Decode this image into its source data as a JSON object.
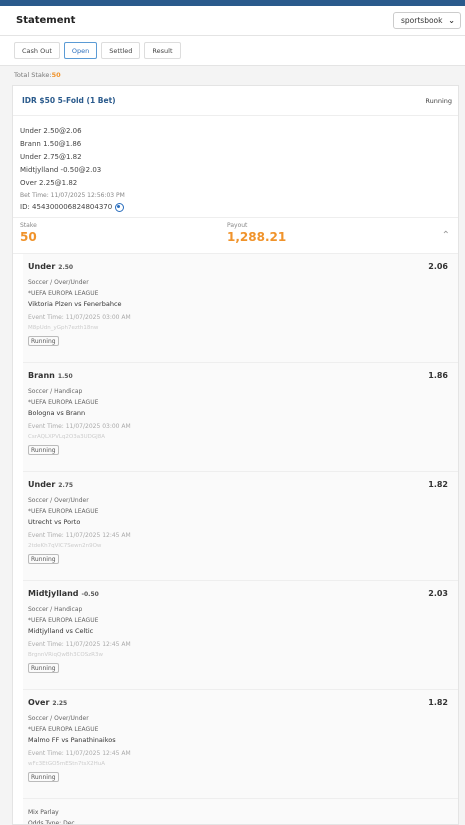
{
  "header": {
    "title": "Statement",
    "dropdown_value": "sportsbook"
  },
  "tabs": [
    {
      "label": "Cash Out",
      "active": false
    },
    {
      "label": "Open",
      "active": true
    },
    {
      "label": "Settled",
      "active": false
    },
    {
      "label": "Result",
      "active": false
    }
  ],
  "total_stake": {
    "label": "Total Stake:",
    "value": "50"
  },
  "bet": {
    "title": "IDR $50 5-Fold (1 Bet)",
    "status": "Running",
    "summary": [
      "Under 2.50@2.06",
      "Brann 1.50@1.86",
      "Under 2.75@1.82",
      "Midtjylland -0.50@2.03",
      "Over 2.25@1.82"
    ],
    "bet_time": "Bet Time: 11/07/2025 12:56:03 PM",
    "bet_id": "ID: 454300006824804370",
    "stake_label": "Stake",
    "stake_value": "50",
    "payout_label": "Payout",
    "payout_value": "1,288.21",
    "legs": [
      {
        "selection": "Under",
        "hdp": "2.50",
        "odds": "2.06",
        "market": "Soccer / Over/Under",
        "league": "*UEFA EUROPA LEAGUE",
        "match": "Viktoria Plzen vs Fenerbahce",
        "event_time": "Event Time: 11/07/2025 03:00 AM",
        "code": "M8pUdn_yGph7ezth18nw",
        "status": "Running"
      },
      {
        "selection": "Brann",
        "hdp": "1.50",
        "odds": "1.86",
        "market": "Soccer / Handicap",
        "league": "*UEFA EUROPA LEAGUE",
        "match": "Bologna vs Brann",
        "event_time": "Event Time: 11/07/2025 03:00 AM",
        "code": "CsrAQLXPVLq2O3a3UDGJ8A",
        "status": "Running"
      },
      {
        "selection": "Under",
        "hdp": "2.75",
        "odds": "1.82",
        "market": "Soccer / Over/Under",
        "league": "*UEFA EUROPA LEAGUE",
        "match": "Utrecht vs Porto",
        "event_time": "Event Time: 11/07/2025 12:45 AM",
        "code": "2tdeKh7qVlC7Sewn2n9Ow",
        "status": "Running"
      },
      {
        "selection": "Midtjylland",
        "hdp": "-0.50",
        "odds": "2.03",
        "market": "Soccer / Handicap",
        "league": "*UEFA EUROPA LEAGUE",
        "match": "Midtjylland vs Celtic",
        "event_time": "Event Time: 11/07/2025 12:45 AM",
        "code": "BrgnnVRiqQwBh3COSzR3w",
        "status": "Running"
      },
      {
        "selection": "Over",
        "hdp": "2.25",
        "odds": "1.82",
        "market": "Soccer / Over/Under",
        "league": "*UEFA EUROPA LEAGUE",
        "match": "Malmo FF vs Panathinaikos",
        "event_time": "Event Time: 11/07/2025 12:45 AM",
        "code": "wFc3EtGO5mEStn7tsX2HuA",
        "status": "Running"
      }
    ],
    "footer_type": "Mix Parlay",
    "footer_odds_type": "Odds Type:  Dec"
  },
  "icons": {
    "dropdown": "chevron-down-icon",
    "bet_id_copy": "copy-icon",
    "collapse": "chevron-up-icon"
  },
  "colors": {
    "accent": "#2a5a8c",
    "highlight": "#f0932b",
    "active_tab": "#2a6ebd"
  }
}
